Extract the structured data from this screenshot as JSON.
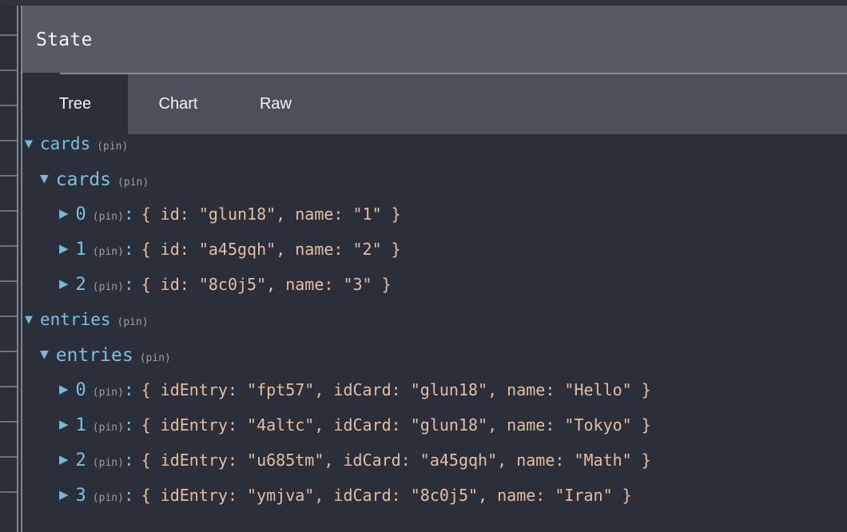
{
  "window": {
    "title": "State"
  },
  "tabs": [
    {
      "id": "tree",
      "label": "Tree",
      "active": true
    },
    {
      "id": "chart",
      "label": "Chart",
      "active": false
    },
    {
      "id": "raw",
      "label": "Raw",
      "active": false
    }
  ],
  "labels": {
    "pin": "(pin)",
    "colon": ":",
    "arrow_expanded": "▼",
    "arrow_collapsed": "▶"
  },
  "tree": {
    "cards_root": {
      "key": "cards",
      "pin": "(pin)"
    },
    "cards_child": {
      "key": "cards",
      "pin": "(pin)"
    },
    "cards_items": [
      {
        "index": "0",
        "pin": "(pin)",
        "colon": ":",
        "preview": "{ id: \"glun18\", name: \"1\" }"
      },
      {
        "index": "1",
        "pin": "(pin)",
        "colon": ":",
        "preview": "{ id: \"a45gqh\", name: \"2\" }"
      },
      {
        "index": "2",
        "pin": "(pin)",
        "colon": ":",
        "preview": "{ id: \"8c0j5\", name: \"3\" }"
      }
    ],
    "entries_root": {
      "key": "entries",
      "pin": "(pin)"
    },
    "entries_child": {
      "key": "entries",
      "pin": "(pin)"
    },
    "entries_items": [
      {
        "index": "0",
        "pin": "(pin)",
        "colon": ":",
        "preview": "{ idEntry: \"fpt57\", idCard: \"glun18\", name: \"Hello\" }"
      },
      {
        "index": "1",
        "pin": "(pin)",
        "colon": ":",
        "preview": "{ idEntry: \"4altc\", idCard: \"glun18\", name: \"Tokyo\" }"
      },
      {
        "index": "2",
        "pin": "(pin)",
        "colon": ":",
        "preview": "{ idEntry: \"u685tm\", idCard: \"a45gqh\", name: \"Math\" }"
      },
      {
        "index": "3",
        "pin": "(pin)",
        "colon": ":",
        "preview": "{ idEntry: \"ymjva\", idCard: \"8c0j5\", name: \"Iran\" }"
      }
    ]
  },
  "colors": {
    "background": "#2b2f3a",
    "titlebar": "#555a63",
    "tabbar": "#4b505a",
    "key": "#7cc0e0",
    "value": "#e3bfa2",
    "muted": "#9aa0ab",
    "text": "#f2f3f5",
    "divider": "#80848e"
  }
}
